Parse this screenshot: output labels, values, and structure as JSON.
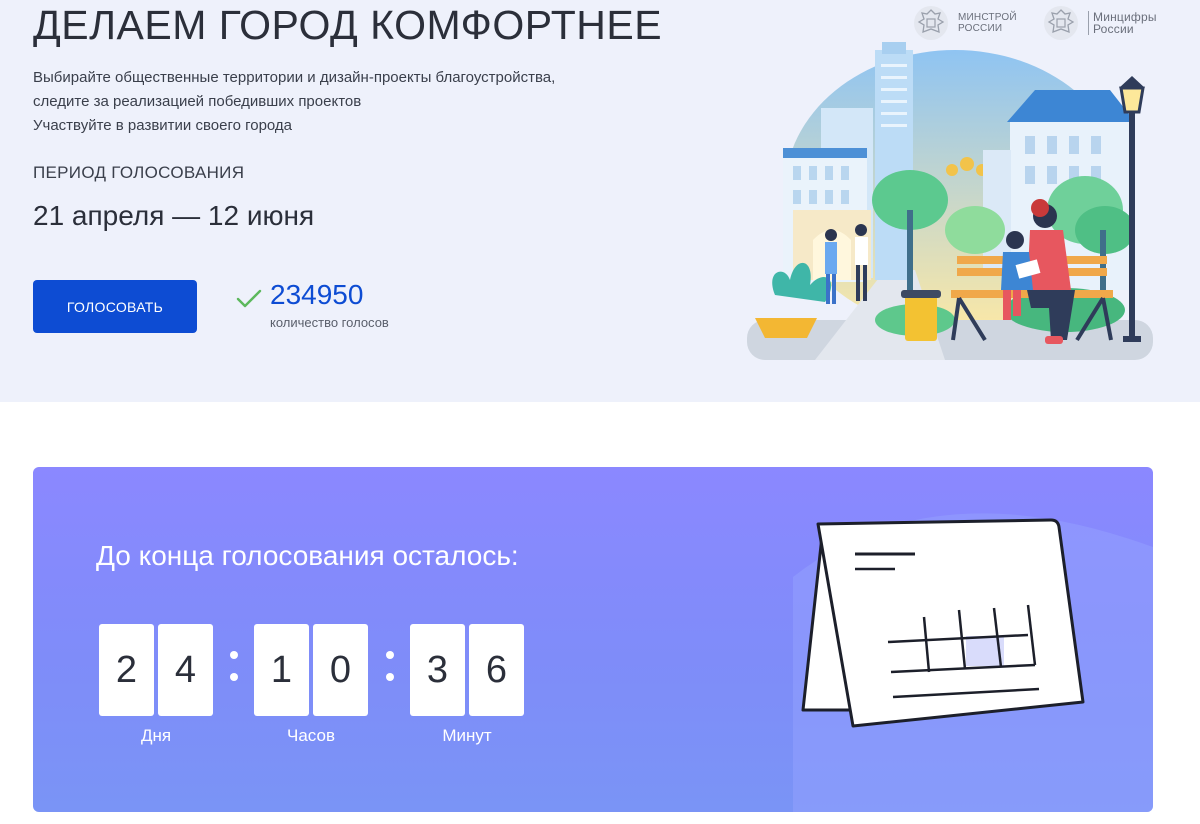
{
  "hero": {
    "title": "ДЕЛАЕМ ГОРОД КОМФОРТНЕЕ",
    "description": [
      "Выбирайте общественные территории и дизайн-проекты благоустройства,",
      "следите за реализацией победивших проектов",
      "Участвуйте в развитии своего города"
    ],
    "period_label": "ПЕРИОД ГОЛОСОВАНИЯ",
    "period_dates": "21 апреля — 12 июня",
    "vote_button": "ГОЛОСОВАТЬ",
    "votes_count": "234950",
    "votes_caption": "количество голосов"
  },
  "logos": {
    "minstroy": [
      "МИНСТРОЙ",
      "РОССИИ"
    ],
    "mincifry": [
      "Минцифры",
      "России"
    ]
  },
  "countdown": {
    "title": "До конца голосования осталось:",
    "days": [
      "2",
      "4"
    ],
    "hours": [
      "1",
      "0"
    ],
    "minutes": [
      "3",
      "6"
    ],
    "days_label": "Дня",
    "hours_label": "Часов",
    "minutes_label": "Минут"
  },
  "colors": {
    "accent": "#0d4cd3",
    "hero_bg": "#eef1fb",
    "countdown_bg": "#8b88ff",
    "check": "#5cb85c"
  },
  "icons": [
    "check-icon",
    "emblem-icon",
    "calendar-icon",
    "city-illustration"
  ]
}
